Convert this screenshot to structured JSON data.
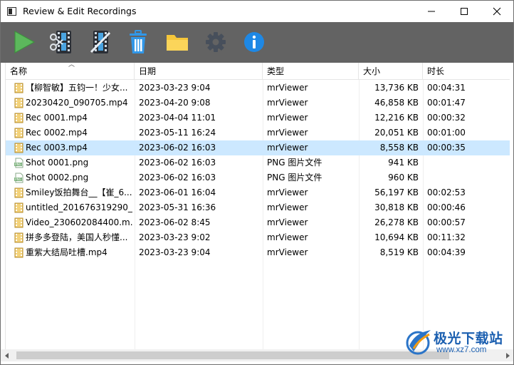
{
  "window": {
    "title": "Review & Edit Recordings"
  },
  "toolbar": {
    "buttons": [
      {
        "name": "play",
        "icon": "play-icon",
        "color": "#4caf50"
      },
      {
        "name": "edit-video",
        "icon": "film-edit-icon",
        "color": "#3a9ad9"
      },
      {
        "name": "trim-video",
        "icon": "film-cut-icon",
        "color": "#3a9ad9"
      },
      {
        "name": "delete",
        "icon": "trash-icon",
        "color": "#2f8fe0"
      },
      {
        "name": "open-folder",
        "icon": "folder-icon",
        "color": "#f2c230"
      },
      {
        "name": "settings",
        "icon": "gear-icon",
        "color": "#4a5360"
      },
      {
        "name": "about",
        "icon": "info-icon",
        "color": "#1e88e5"
      }
    ]
  },
  "list": {
    "columns": [
      "名称",
      "日期",
      "类型",
      "大小",
      "时长"
    ],
    "selected_index": 4,
    "rows": [
      {
        "name": "【柳智敏】五钧一！少女...",
        "date": "2023-03-23 9:04",
        "type": "mrViewer",
        "size": "13,736 KB",
        "duration": "00:04:31",
        "icon": "video-file-icon"
      },
      {
        "name": "20230420_090705.mp4",
        "date": "2023-04-20 9:08",
        "type": "mrViewer",
        "size": "46,858 KB",
        "duration": "00:01:47",
        "icon": "video-file-icon"
      },
      {
        "name": "Rec 0001.mp4",
        "date": "2023-04-04 11:01",
        "type": "mrViewer",
        "size": "12,216 KB",
        "duration": "00:00:32",
        "icon": "video-file-icon"
      },
      {
        "name": "Rec 0002.mp4",
        "date": "2023-05-11 16:24",
        "type": "mrViewer",
        "size": "20,051 KB",
        "duration": "00:01:00",
        "icon": "video-file-icon"
      },
      {
        "name": "Rec 0003.mp4",
        "date": "2023-06-02 16:03",
        "type": "mrViewer",
        "size": "8,558 KB",
        "duration": "00:00:35",
        "icon": "video-file-icon"
      },
      {
        "name": "Shot 0001.png",
        "date": "2023-06-02 16:03",
        "type": "PNG 图片文件",
        "size": "941 KB",
        "duration": "",
        "icon": "png-file-icon"
      },
      {
        "name": "Shot 0002.png",
        "date": "2023-06-02 16:03",
        "type": "PNG 图片文件",
        "size": "960 KB",
        "duration": "",
        "icon": "png-file-icon"
      },
      {
        "name": "Smiley饭拍舞台__【崔_6...",
        "date": "2023-06-01 16:04",
        "type": "mrViewer",
        "size": "56,197 KB",
        "duration": "00:02:53",
        "icon": "video-file-icon"
      },
      {
        "name": "untitled_201676319290_...",
        "date": "2023-05-31 16:36",
        "type": "mrViewer",
        "size": "30,818 KB",
        "duration": "00:00:46",
        "icon": "video-file-icon"
      },
      {
        "name": "Video_230602084400.m...",
        "date": "2023-06-02 8:45",
        "type": "mrViewer",
        "size": "26,278 KB",
        "duration": "00:00:57",
        "icon": "video-file-icon"
      },
      {
        "name": "拼多多登陆，美国人秒懂...",
        "date": "2023-03-23 9:02",
        "type": "mrViewer",
        "size": "10,694 KB",
        "duration": "00:11:32",
        "icon": "video-file-icon"
      },
      {
        "name": "重紫大结局吐槽.mp4",
        "date": "2023-03-23 9:04",
        "type": "mrViewer",
        "size": "8,519 KB",
        "duration": "00:04:39",
        "icon": "video-file-icon"
      }
    ]
  },
  "watermark": {
    "title": "极光下载站",
    "url": "www.xz7.com"
  }
}
